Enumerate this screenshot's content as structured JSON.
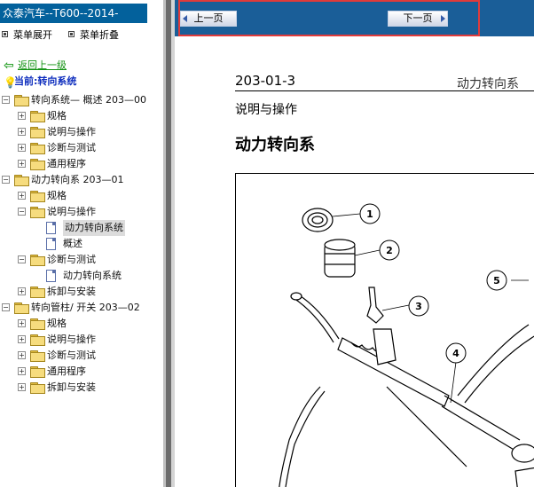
{
  "sidebar": {
    "brand": "众泰汽车--T600--2014-",
    "expand_label": "菜单展开",
    "collapse_label": "菜单折叠",
    "back_label": "返回上一级",
    "current_label": "当前:转向系统",
    "tree": [
      {
        "label": "转向系统— 概述 203—00",
        "level": 0,
        "toggle": "−",
        "icon": "folder-icon"
      },
      {
        "label": "规格",
        "level": 1,
        "toggle": "+",
        "icon": "folder-icon"
      },
      {
        "label": "说明与操作",
        "level": 1,
        "toggle": "+",
        "icon": "folder-icon"
      },
      {
        "label": "诊断与测试",
        "level": 1,
        "toggle": "+",
        "icon": "folder-icon"
      },
      {
        "label": "通用程序",
        "level": 1,
        "toggle": "+",
        "icon": "folder-icon"
      },
      {
        "label": "动力转向系 203—01",
        "level": 0,
        "toggle": "−",
        "icon": "folder-icon"
      },
      {
        "label": "规格",
        "level": 1,
        "toggle": "+",
        "icon": "folder-icon"
      },
      {
        "label": "说明与操作",
        "level": 1,
        "toggle": "−",
        "icon": "folder-icon"
      },
      {
        "label": "动力转向系统",
        "level": 2,
        "toggle": "",
        "icon": "document-icon",
        "selected": true
      },
      {
        "label": "概述",
        "level": 2,
        "toggle": "",
        "icon": "document-icon"
      },
      {
        "label": "诊断与测试",
        "level": 1,
        "toggle": "−",
        "icon": "folder-icon"
      },
      {
        "label": "动力转向系统",
        "level": 2,
        "toggle": "",
        "icon": "document-icon"
      },
      {
        "label": "拆卸与安装",
        "level": 1,
        "toggle": "+",
        "icon": "folder-icon"
      },
      {
        "label": "转向管柱/ 开关 203—02",
        "level": 0,
        "toggle": "−",
        "icon": "folder-icon"
      },
      {
        "label": "规格",
        "level": 1,
        "toggle": "+",
        "icon": "folder-icon"
      },
      {
        "label": "说明与操作",
        "level": 1,
        "toggle": "+",
        "icon": "folder-icon"
      },
      {
        "label": "诊断与测试",
        "level": 1,
        "toggle": "+",
        "icon": "folder-icon"
      },
      {
        "label": "通用程序",
        "level": 1,
        "toggle": "+",
        "icon": "folder-icon"
      },
      {
        "label": "拆卸与安装",
        "level": 1,
        "toggle": "+",
        "icon": "folder-icon"
      }
    ]
  },
  "nav": {
    "prev_label": "上一页",
    "next_label": "下一页",
    "prev_icon": "left-arrow-icon",
    "next_icon": "right-arrow-icon"
  },
  "document": {
    "code": "203-01-3",
    "header_title": "动力转向系",
    "section": "说明与操作",
    "heading": "动力转向系",
    "callouts": [
      "1",
      "2",
      "3",
      "4",
      "5"
    ]
  },
  "colors": {
    "brand_bg": "#03619c",
    "nav_bg": "#1a5e98",
    "highlight_border": "#e03b3b",
    "link_green": "#139213",
    "current_blue": "#0c2cbd"
  }
}
